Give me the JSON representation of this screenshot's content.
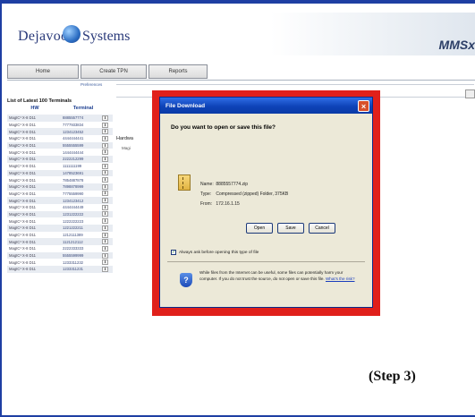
{
  "header": {
    "logo_left": "Dejavoo",
    "logo_right": "Systems",
    "brand": "MMSx"
  },
  "nav": {
    "tabs": [
      "Home",
      "Create TPN",
      "Reports"
    ],
    "preferences": "Preferences"
  },
  "sidebar": {
    "title": "List of Latest 100 Terminals",
    "col_hw": "HW",
    "col_terminal": "Terminal",
    "rows": [
      {
        "hw": "MagIC³ X-8 D11",
        "terminal": "8885557774"
      },
      {
        "hw": "MagIC³ X-8 D11",
        "terminal": "7777933834"
      },
      {
        "hw": "MagIC³ X-8 D11",
        "terminal": "1234123452"
      },
      {
        "hw": "MagIC³ X-8 D11",
        "terminal": "4444444441"
      },
      {
        "hw": "MagIC³ X-8 D11",
        "terminal": "5555555599"
      },
      {
        "hw": "MagIC³ X-8 D11",
        "terminal": "1444444444"
      },
      {
        "hw": "MagIC³ X-8 D11",
        "terminal": "2222212299"
      },
      {
        "hw": "MagIC³ X-8 D11",
        "terminal": "1111111199"
      },
      {
        "hw": "MagIC³ X-8 D11",
        "terminal": "1478523691"
      },
      {
        "hw": "MagIC³ X-8 D11",
        "terminal": "7854887878"
      },
      {
        "hw": "MagIC³ X-8 D11",
        "terminal": "7898878999"
      },
      {
        "hw": "MagIC³ X-8 D11",
        "terminal": "7775559990"
      },
      {
        "hw": "MagIC³ X-8 D11",
        "terminal": "1234123412"
      },
      {
        "hw": "MagIC³ X-8 D11",
        "terminal": "4444444449"
      },
      {
        "hw": "MagIC³ X-8 D11",
        "terminal": "1231222222"
      },
      {
        "hw": "MagIC³ X-8 D11",
        "terminal": "1222222223"
      },
      {
        "hw": "MagIC³ X-8 D11",
        "terminal": "1221222211"
      },
      {
        "hw": "MagIC³ X-8 D11",
        "terminal": "1212111389"
      },
      {
        "hw": "MagIC³ X-8 D11",
        "terminal": "1121212112"
      },
      {
        "hw": "MagIC³ X-8 D11",
        "terminal": "2222333333"
      },
      {
        "hw": "MagIC³ X-8 D11",
        "terminal": "5555599999"
      },
      {
        "hw": "MagIC³ X-8 D11",
        "terminal": "1233311232"
      },
      {
        "hw": "MagIC³ X-8 D11",
        "terminal": "1233311231"
      }
    ]
  },
  "main": {
    "hardware_label": "Hardwa",
    "hardware_sub": "Magi"
  },
  "dialog": {
    "title": "File Download",
    "close": "×",
    "question": "Do you want to open or save this file?",
    "name_label": "Name:",
    "name_value": "8885557774.zip",
    "type_label": "Type:",
    "type_value": "Compressed (zipped) Folder, 375KB",
    "from_label": "From:",
    "from_value": "172.16.1.15",
    "open": "Open",
    "save": "Save",
    "cancel": "Cancel",
    "always_ask": "Always ask before opening this type of file",
    "warning": "While files from the Internet can be useful, some files can potentially harm your computer. If you do not trust the source, do not open or save this file.",
    "risk_link": "What's the risk?"
  },
  "step_label": "(Step 3)"
}
